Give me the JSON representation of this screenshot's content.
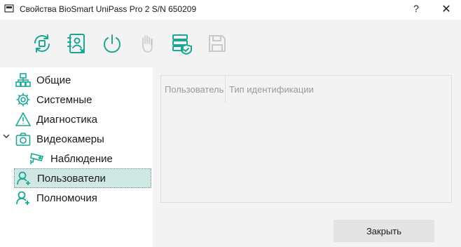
{
  "window": {
    "title": "Свойства BioSmart UniPass Pro 2 S/N 650209",
    "help_glyph": "?",
    "close_glyph": "✕"
  },
  "toolbar": {
    "tools": [
      {
        "name": "sync-icon"
      },
      {
        "name": "user-list-icon"
      },
      {
        "name": "power-icon"
      },
      {
        "name": "hand-icon"
      },
      {
        "name": "server-shield-icon"
      },
      {
        "name": "save-icon"
      }
    ],
    "accent_color": "#1aa894",
    "disabled_color": "#c9c9c9"
  },
  "nav": {
    "items": [
      {
        "label": "Общие",
        "icon": "network-icon"
      },
      {
        "label": "Системные",
        "icon": "gear-icon"
      },
      {
        "label": "Диагностика",
        "icon": "warning-icon"
      },
      {
        "label": "Видеокамеры",
        "icon": "camera-icon",
        "expanded": true
      },
      {
        "label": "Наблюдение",
        "icon": "cctv-icon"
      },
      {
        "label": "Пользователи",
        "icon": "user-add-icon",
        "selected": true
      },
      {
        "label": "Полномочия",
        "icon": "user-add-icon"
      }
    ]
  },
  "grid": {
    "columns": [
      "Пользователь",
      "Тип идентификации"
    ]
  },
  "buttons": {
    "close_label": "Закрыть"
  }
}
